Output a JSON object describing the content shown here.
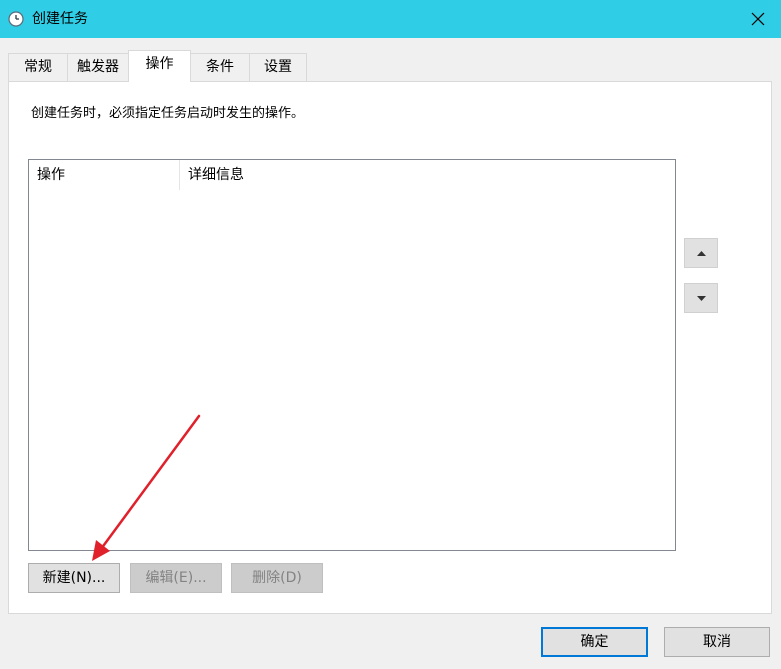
{
  "window": {
    "title": "创建任务",
    "icon": "clock-icon",
    "close_icon": "close-icon"
  },
  "tabs": [
    {
      "label": "常规",
      "active": false
    },
    {
      "label": "触发器",
      "active": false
    },
    {
      "label": "操作",
      "active": true
    },
    {
      "label": "条件",
      "active": false
    },
    {
      "label": "设置",
      "active": false
    }
  ],
  "actions_tab": {
    "description": "创建任务时，必须指定任务启动时发生的操作。",
    "list": {
      "columns": [
        "操作",
        "详细信息"
      ],
      "rows": []
    },
    "move_up_icon": "triangle-up-icon",
    "move_down_icon": "triangle-down-icon",
    "new_label": "新建(N)...",
    "edit_label": "编辑(E)...",
    "delete_label": "删除(D)"
  },
  "footer": {
    "ok_label": "确定",
    "cancel_label": "取消"
  },
  "annotation": {
    "type": "red-arrow",
    "color": "#e0202a",
    "points_to": "new-button"
  },
  "colors": {
    "titlebar": "#2fcee6",
    "accent": "#0078d7",
    "window_bg": "#f0f0f0"
  }
}
